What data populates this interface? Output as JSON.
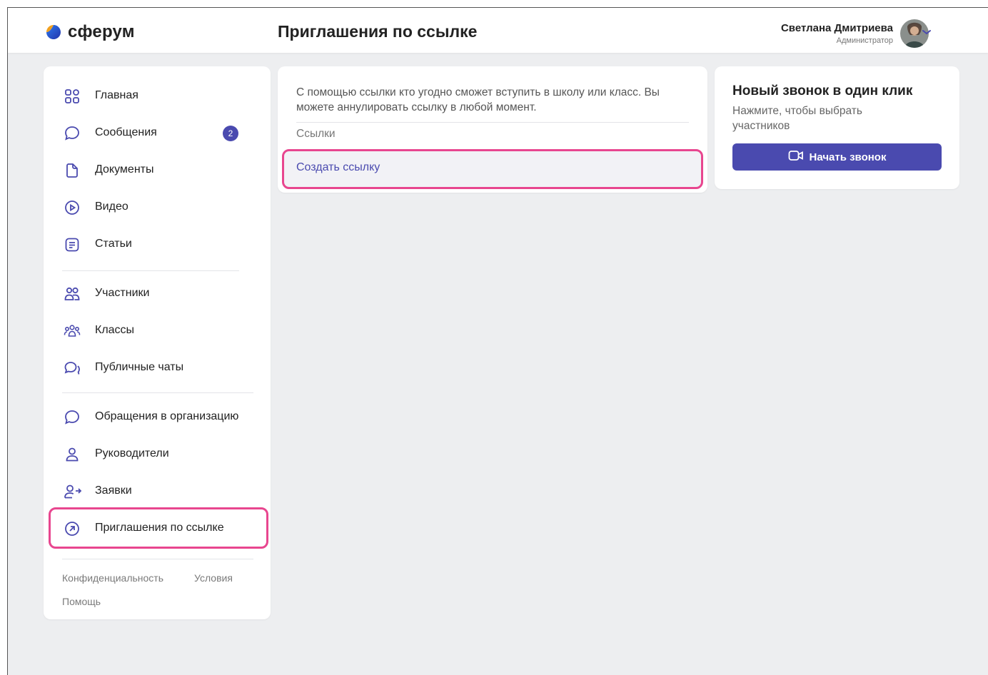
{
  "brand": {
    "name": "сферум",
    "accent": "#4a4aaf",
    "highlight": "#e8468f"
  },
  "header": {
    "page_title": "Приглашения по ссылке",
    "user_name": "Светлана Дмитриева",
    "user_role": "Администратор"
  },
  "sidebar": {
    "items": [
      {
        "label": "Главная",
        "icon": "grid-icon"
      },
      {
        "label": "Сообщения",
        "icon": "chat-bubble-icon",
        "badge": "2"
      },
      {
        "label": "Документы",
        "icon": "document-icon"
      },
      {
        "label": "Видео",
        "icon": "play-circle-icon"
      },
      {
        "label": "Статьи",
        "icon": "article-icon"
      },
      {
        "label": "Участники",
        "icon": "people-icon"
      },
      {
        "label": "Классы",
        "icon": "classes-icon"
      },
      {
        "label": "Публичные чаты",
        "icon": "public-chats-icon"
      },
      {
        "label": "Обращения в организацию",
        "icon": "chat-bubble-icon"
      },
      {
        "label": "Руководители",
        "icon": "person-icon"
      },
      {
        "label": "Заявки",
        "icon": "person-arrow-icon"
      },
      {
        "label": "Приглашения по ссылке",
        "icon": "arrow-circle-icon",
        "active": true
      }
    ],
    "footer": {
      "privacy": "Конфиденциальность",
      "terms": "Условия",
      "help": "Помощь"
    }
  },
  "main": {
    "description": "С помощью ссылки кто угодно сможет вступить в школу или класс. Вы можете аннулировать ссылку в любой момент.",
    "links_label": "Ссылки",
    "create_link_label": "Создать ссылку"
  },
  "call": {
    "title": "Новый звонок в один клик",
    "subtitle": "Нажмите, чтобы выбрать участников",
    "button_label": "Начать звонок"
  }
}
